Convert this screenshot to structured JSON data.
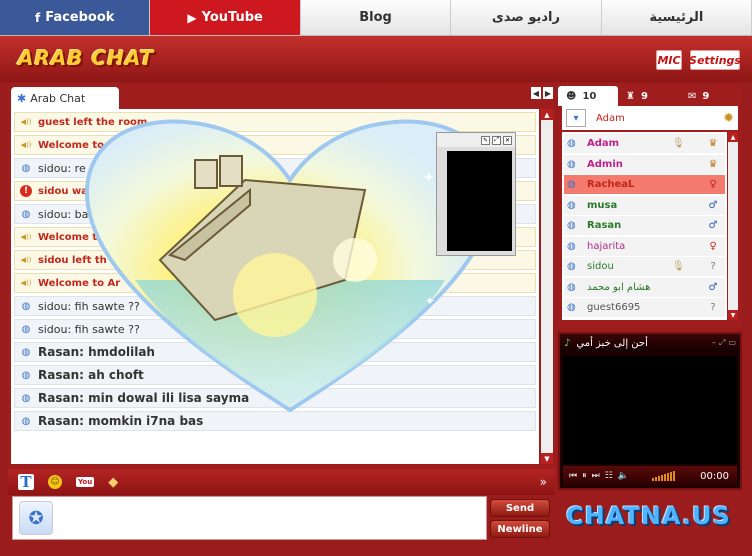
{
  "topnav": {
    "tabs": [
      {
        "label": "Facebook",
        "icon": "facebook-icon"
      },
      {
        "label": "YouTube",
        "icon": "youtube-icon"
      },
      {
        "label": "Blog"
      },
      {
        "label": "راديو صدى"
      },
      {
        "label": "الرئيسية"
      }
    ]
  },
  "header": {
    "logo": "ARAB CHAT",
    "mic_label": "MIC",
    "settings_label": "Settings"
  },
  "chat": {
    "room_tab": "Arab Chat",
    "messages": [
      {
        "type": "sys",
        "icon": "speaker-icon",
        "text": "guest left the room"
      },
      {
        "type": "sys",
        "icon": "speaker-icon",
        "text": "Welcome to Ar"
      },
      {
        "type": "plain",
        "icon": "speech-bubble-icon",
        "text": "sidou: re"
      },
      {
        "type": "sys",
        "icon": "warning-icon",
        "text": "sidou was"
      },
      {
        "type": "plain",
        "icon": "speech-bubble-icon",
        "text": "sidou: ba"
      },
      {
        "type": "sys",
        "icon": "speaker-icon",
        "text": "Welcome t"
      },
      {
        "type": "sys",
        "icon": "speaker-icon",
        "text": "sidou left th"
      },
      {
        "type": "sys",
        "icon": "speaker-icon",
        "text": "Welcome to Ar"
      },
      {
        "type": "plain",
        "icon": "speech-bubble-icon",
        "text": "sidou: fih sawte ??"
      },
      {
        "type": "plain",
        "icon": "speech-bubble-icon",
        "text": "sidou: fih sawte ??"
      },
      {
        "type": "rasan",
        "icon": "speech-bubble-icon",
        "text": "Rasan: hmdolilah"
      },
      {
        "type": "rasan",
        "icon": "speech-bubble-icon",
        "text": "Rasan: ah choft"
      },
      {
        "type": "rasan",
        "icon": "speech-bubble-icon",
        "text": "Rasan: min dowal ili lisa sayma"
      },
      {
        "type": "rasan",
        "icon": "speech-bubble-icon",
        "text": "Rasan: momkin i7na bas"
      }
    ]
  },
  "composer": {
    "send_label": "Send",
    "newline_label": "Newline"
  },
  "users": {
    "tabs": [
      {
        "count": "10",
        "icon": "users-icon"
      },
      {
        "count": "9",
        "icon": "rooms-icon"
      },
      {
        "count": "9",
        "icon": "private-chat-icon"
      }
    ],
    "search_name": "Adam",
    "list": [
      {
        "name": "Adam",
        "color": "#c21f8a",
        "bold": true,
        "mic": true,
        "role": "admin"
      },
      {
        "name": "Admin",
        "color": "#c21f8a",
        "bold": true,
        "mic": false,
        "role": "admin"
      },
      {
        "name": "RacheaL",
        "color": "#c2271c",
        "bold": true,
        "mic": false,
        "role": "female",
        "selected": true
      },
      {
        "name": "musa",
        "color": "#2a7a2a",
        "bold": true,
        "mic": false,
        "role": "male"
      },
      {
        "name": "Rasan",
        "color": "#2a7a2a",
        "bold": true,
        "mic": false,
        "role": "male"
      },
      {
        "name": "hajarita",
        "color": "#b02a8a",
        "bold": false,
        "mic": false,
        "role": "female"
      },
      {
        "name": "sidou",
        "color": "#2a7a2a",
        "bold": false,
        "mic": true,
        "role": "unknown"
      },
      {
        "name": "هشام ابو محمد",
        "color": "#2a7a2a",
        "bold": false,
        "mic": false,
        "role": "male"
      },
      {
        "name": "guest6695",
        "color": "#555555",
        "bold": false,
        "mic": false,
        "role": "unknown"
      }
    ]
  },
  "player": {
    "station": "أحن إلى خبز أمي",
    "time": "00:00"
  },
  "brand": "CHATNA.US",
  "colors": {
    "primary_red": "#a01d1d",
    "system_msg": "#c2271c",
    "rasan_msg": "#2a2acf",
    "facebook": "#3b5998",
    "youtube": "#cc181e"
  }
}
